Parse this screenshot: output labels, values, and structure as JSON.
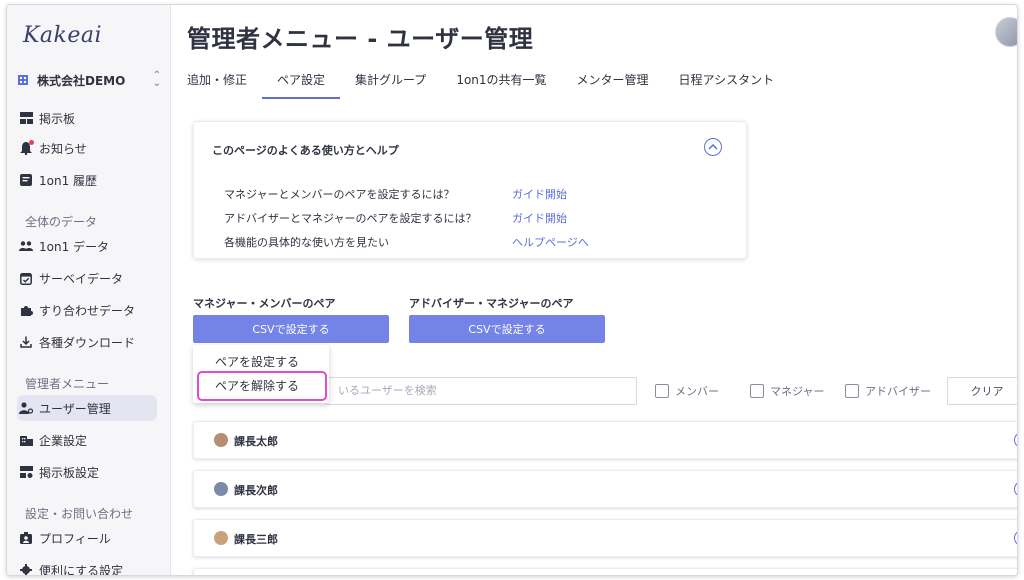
{
  "app": {
    "logo": "Kakeai",
    "company": "株式会社DEMO"
  },
  "sidebar": {
    "items_top": [
      {
        "label": "掲示板",
        "icon": "board-icon"
      },
      {
        "label": "お知らせ",
        "icon": "bell-icon"
      },
      {
        "label": "1on1 履歴",
        "icon": "history-icon"
      }
    ],
    "section_data": "全体のデータ",
    "items_data": [
      {
        "label": "1on1 データ",
        "icon": "people-icon"
      },
      {
        "label": "サーベイデータ",
        "icon": "calendar-check-icon"
      },
      {
        "label": "すり合わせデータ",
        "icon": "puzzle-icon"
      },
      {
        "label": "各種ダウンロード",
        "icon": "download-icon"
      }
    ],
    "section_admin": "管理者メニュー",
    "items_admin": [
      {
        "label": "ユーザー管理",
        "icon": "user-manage-icon",
        "active": true
      },
      {
        "label": "企業設定",
        "icon": "company-icon"
      },
      {
        "label": "掲示板設定",
        "icon": "board-settings-icon"
      }
    ],
    "section_settings": "設定・お問い合わせ",
    "items_settings": [
      {
        "label": "プロフィール",
        "icon": "profile-icon"
      },
      {
        "label": "便利にする設定",
        "icon": "settings-icon"
      }
    ]
  },
  "header": {
    "title": "管理者メニュー - ユーザー管理"
  },
  "tabs": [
    {
      "label": "追加・修正"
    },
    {
      "label": "ペア設定",
      "active": true
    },
    {
      "label": "集計グループ"
    },
    {
      "label": "1on1の共有一覧"
    },
    {
      "label": "メンター管理"
    },
    {
      "label": "日程アシスタント"
    }
  ],
  "help": {
    "title": "このページのよくある使い方とヘルプ",
    "rows": [
      {
        "text": "マネジャーとメンバーのペアを設定するには？",
        "link": "ガイド開始"
      },
      {
        "text": "アドバイザーとマネジャーのペアを設定するには？",
        "link": "ガイド開始"
      },
      {
        "text": "各機能の具体的な使い方を見たい",
        "link": "ヘルプページへ"
      }
    ]
  },
  "pairs": {
    "manager_member_label": "マネジャー・メンバーのペア",
    "advisor_manager_label": "アドバイザー・マネジャーのペア",
    "csv_button": "CSVで設定する"
  },
  "dropdown": {
    "items": [
      "ペアを設定する",
      "ペアを解除する"
    ],
    "highlighted": 1
  },
  "filter": {
    "search_placeholder": "いるユーザーを検索",
    "checkboxes": [
      "メンバー",
      "マネジャー",
      "アドバイザー"
    ],
    "clear": "クリア"
  },
  "users": [
    {
      "name": "課長太郎"
    },
    {
      "name": "課長次郎"
    },
    {
      "name": "課長三郎"
    }
  ],
  "colors": {
    "accent": "#5f6fd6",
    "button": "#7383e6",
    "highlight": "#e04bd0"
  }
}
